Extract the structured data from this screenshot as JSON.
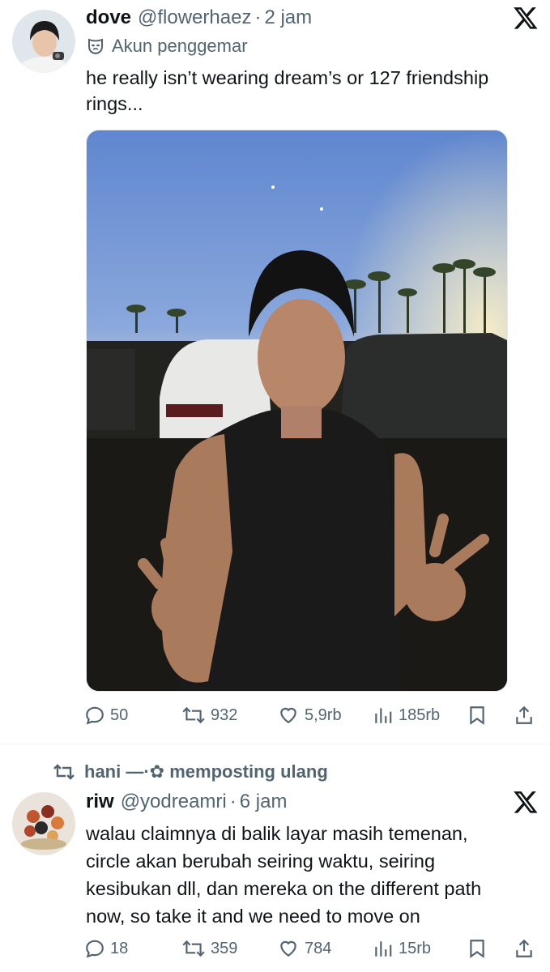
{
  "tweet1": {
    "display_name": "dove",
    "handle": "@flowerhaez",
    "separator": "·",
    "time": "2 jam",
    "label": "Akun penggemar",
    "text": "he really isn’t wearing dream’s or 127 friendship\nrings...",
    "actions": {
      "replies": "50",
      "reposts": "932",
      "likes": "5,9rb",
      "views": "185rb"
    }
  },
  "repost_banner": {
    "text": "hani —·✿ memposting ulang"
  },
  "tweet2": {
    "display_name": "riw",
    "handle": "@yodreamri",
    "separator": "·",
    "time": "6 jam",
    "text": "walau claimnya di balik layar masih temenan,\ncircle akan berubah seiring waktu, seiring\nkesibukan dll, dan mereka on the different path\nnow, so take it and we need to move on",
    "actions": {
      "replies": "18",
      "reposts": "359",
      "likes": "784",
      "views": "15rb"
    }
  },
  "icons": {
    "x_logo": "x-logo-icon",
    "mask": "mask-icon",
    "reply": "reply-icon",
    "repost": "repost-icon",
    "like": "heart-icon",
    "views": "views-icon",
    "bookmark": "bookmark-icon",
    "share": "share-icon"
  },
  "colors": {
    "text_primary": "#0f1419",
    "text_secondary": "#536471",
    "divider": "#eff3f4"
  }
}
